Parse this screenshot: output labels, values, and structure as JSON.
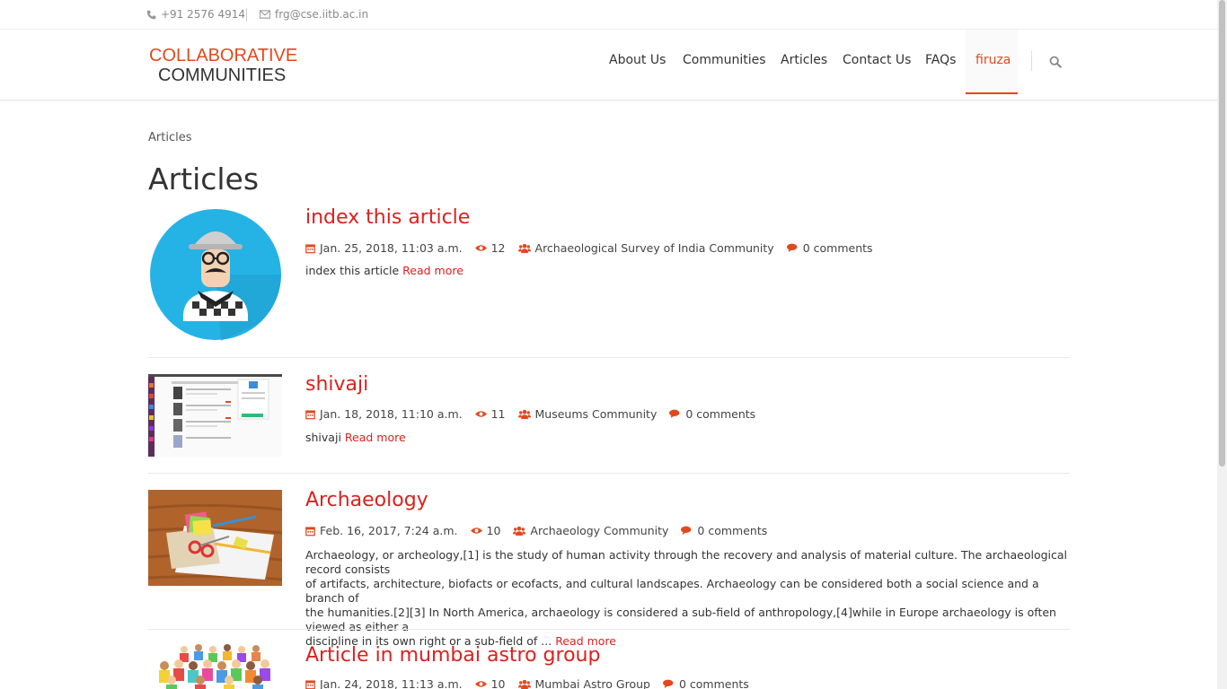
{
  "topbar": {
    "phone": "+91 2576 4914",
    "email": "frg@cse.iitb.ac.in",
    "phone_icon": "phone-icon",
    "email_icon": "envelope-icon"
  },
  "logo": {
    "line1": "COLLABORATIVE",
    "line2": "COMMUNITIES"
  },
  "nav": {
    "items": [
      "About Us",
      "Communities",
      "Articles",
      "Contact Us",
      "FAQs"
    ],
    "active": "firuza",
    "search_icon": "search-icon"
  },
  "colors": {
    "accent": "#e1491f",
    "link": "#d9221f"
  },
  "breadcrumb": "Articles",
  "page_title": "Articles",
  "articles": [
    {
      "title": "index this article",
      "date": "Jan. 25, 2018, 11:03 a.m.",
      "views": "12",
      "community": "Archaeological Survey of India Community",
      "comments": "0 comments",
      "excerpt": "index this article",
      "read_more": "Read more"
    },
    {
      "title": "shivaji",
      "date": "Jan. 18, 2018, 11:10 a.m.",
      "views": "11",
      "community": "Museums Community",
      "comments": "0 comments",
      "excerpt": "shivaji",
      "read_more": "Read more"
    },
    {
      "title": "Archaeology",
      "date": "Feb. 16, 2017, 7:24 a.m.",
      "views": "10",
      "community": "Archaeology Community",
      "comments": "0 comments",
      "excerpt_lines": [
        "Archaeology, or archeology,[1] is the study of human activity through the recovery and analysis of material culture. The archaeological record consists",
        "of artifacts, architecture, biofacts or ecofacts, and cultural landscapes. Archaeology can be considered both a social science and a branch of",
        "the humanities.[2][3] In North America, archaeology is considered a sub-field of anthropology,[4]while in Europe archaeology is often viewed as either a",
        "discipline in its own right or a sub-field of ..."
      ],
      "read_more": "Read more"
    },
    {
      "title": "Article in mumbai astro group",
      "date": "Jan. 24, 2018, 11:13 a.m.",
      "views": "10",
      "community": "Mumbai Astro Group",
      "comments": "0 comments"
    }
  ],
  "meta_icons": [
    "calendar-icon",
    "eye-icon",
    "users-icon",
    "comments-icon"
  ]
}
